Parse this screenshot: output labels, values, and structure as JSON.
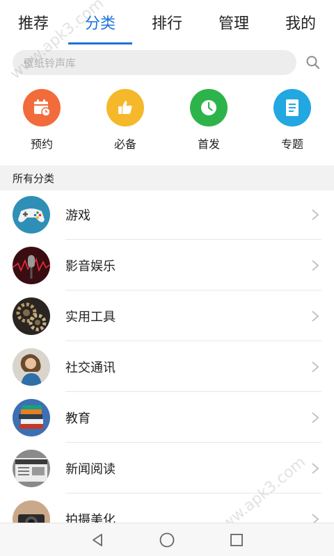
{
  "tabs": [
    {
      "label": "推荐"
    },
    {
      "label": "分类"
    },
    {
      "label": "排行"
    },
    {
      "label": "管理"
    },
    {
      "label": "我的"
    }
  ],
  "active_tab": "分类",
  "search": {
    "placeholder": "壁纸铃声库"
  },
  "quick_links": [
    {
      "label": "预约",
      "color": "#f26b3a",
      "icon": "calendar-clock-icon"
    },
    {
      "label": "必备",
      "color": "#f5b82b",
      "icon": "thumbs-up-icon"
    },
    {
      "label": "首发",
      "color": "#2cb44a",
      "icon": "clock-icon"
    },
    {
      "label": "专题",
      "color": "#22a7e0",
      "icon": "document-icon"
    }
  ],
  "section_title": "所有分类",
  "categories": [
    {
      "label": "游戏",
      "icon": "gamepad-icon"
    },
    {
      "label": "影音娱乐",
      "icon": "microphone-icon"
    },
    {
      "label": "实用工具",
      "icon": "gears-icon"
    },
    {
      "label": "社交通讯",
      "icon": "person-photo-icon"
    },
    {
      "label": "教育",
      "icon": "books-icon"
    },
    {
      "label": "新闻阅读",
      "icon": "newspaper-icon"
    },
    {
      "label": "拍摄美化",
      "icon": "camera-icon"
    }
  ],
  "watermark": "www.apk3.com",
  "colors": {
    "accent": "#1a73d9"
  }
}
